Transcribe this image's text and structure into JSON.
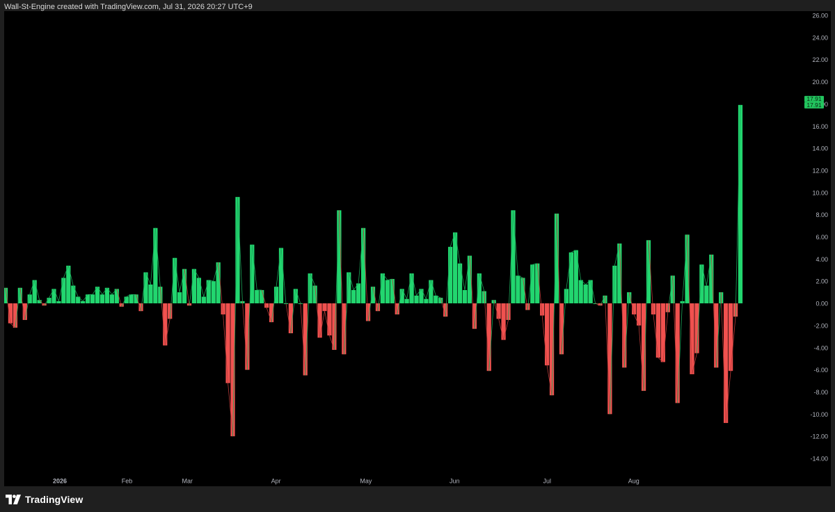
{
  "header": {
    "text": "Wall-St-Engine created with TradingView.com, Jul 31, 2026 20:27 UTC+9"
  },
  "footer": {
    "brand": "TradingView",
    "logo_icon": "tradingview-logo-icon"
  },
  "colors": {
    "up": "#22d66f",
    "down": "#f0514f",
    "up_line": "#1aa458",
    "down_line": "#b83a38",
    "label_bg": "#22c55e",
    "background": "#000000",
    "axis_text": "#b2b5be"
  },
  "chart_data": {
    "type": "bar",
    "ylim": [
      -14,
      26
    ],
    "y_ticks": [
      "26.00",
      "24.00",
      "22.00",
      "20.00",
      "18.00",
      "16.00",
      "14.00",
      "12.00",
      "10.00",
      "8.00",
      "6.00",
      "4.00",
      "2.00",
      "0.00",
      "-2.00",
      "-4.00",
      "-6.00",
      "-8.00",
      "-10.00",
      "-12.00",
      "-14.00"
    ],
    "x_ticks": [
      "2026",
      "Feb",
      "Mar",
      "Apr",
      "May",
      "Jun",
      "Jul",
      "Aug"
    ],
    "last_value_labels": [
      "17.91",
      "17.91"
    ],
    "values": [
      1.4,
      -1.8,
      -2.2,
      1.4,
      -1.5,
      0.8,
      2.1,
      0.3,
      -0.2,
      0.5,
      1.3,
      0.2,
      2.3,
      3.4,
      1.6,
      0.6,
      0.2,
      0.8,
      0.8,
      1.5,
      0.8,
      1.4,
      0.8,
      1.3,
      -0.3,
      0.6,
      0.8,
      0.8,
      -0.7,
      2.8,
      1.7,
      6.8,
      1.5,
      -3.8,
      -1.4,
      4.1,
      1.0,
      3.1,
      -0.2,
      3.1,
      2.3,
      0.6,
      2.1,
      2.0,
      3.7,
      -1.0,
      -7.2,
      -12.0,
      9.6,
      0.2,
      -6.0,
      5.3,
      1.2,
      1.2,
      -0.4,
      -1.7,
      1.5,
      5.0,
      0.0,
      -2.7,
      1.3,
      0.0,
      -6.5,
      2.7,
      1.6,
      -3.1,
      -0.7,
      -2.9,
      -4.2,
      8.4,
      -4.6,
      2.8,
      1.2,
      1.8,
      6.8,
      -1.6,
      1.5,
      -0.7,
      2.7,
      2.1,
      2.2,
      -1.0,
      1.3,
      0.4,
      2.7,
      0.7,
      1.3,
      0.4,
      2.1,
      0.7,
      0.5,
      -1.2,
      5.1,
      6.4,
      3.6,
      1.2,
      4.3,
      -2.3,
      2.7,
      1.1,
      -6.1,
      0.3,
      -1.4,
      -3.3,
      -1.5,
      8.4,
      2.5,
      2.3,
      -0.6,
      3.5,
      3.6,
      -1.1,
      -5.6,
      -8.3,
      8.1,
      -4.6,
      1.3,
      4.6,
      4.8,
      2.1,
      1.7,
      2.1,
      0.0,
      -0.2,
      0.7,
      -10.0,
      3.4,
      5.4,
      -5.8,
      1.0,
      -1.0,
      -2.0,
      -7.9,
      5.7,
      -1.0,
      -4.9,
      -5.3,
      -0.8,
      2.5,
      -9.0,
      0.2,
      6.2,
      -6.4,
      -4.5,
      3.5,
      1.6,
      4.4,
      -5.8,
      1.0,
      -10.8,
      -6.1,
      -1.2,
      17.91
    ]
  }
}
